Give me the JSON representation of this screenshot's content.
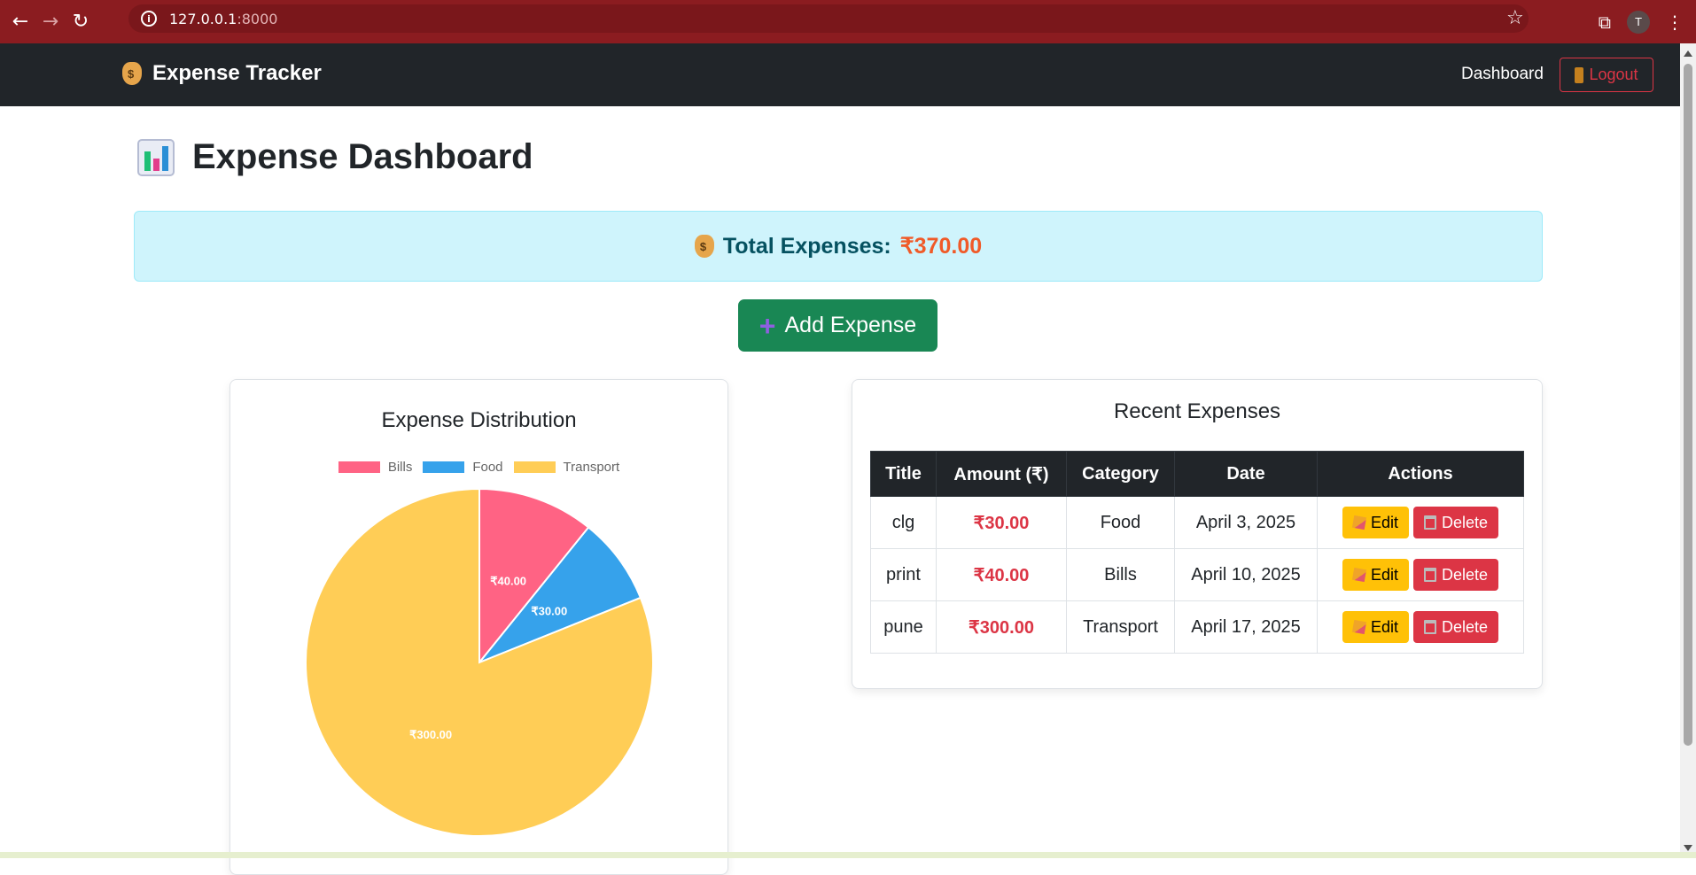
{
  "browser": {
    "url_host": "127.0.0.1",
    "url_port": ":8000",
    "profile_initial": "T"
  },
  "navbar": {
    "brand": "Expense Tracker",
    "dashboard_link": "Dashboard",
    "logout_label": "Logout"
  },
  "page": {
    "title": "Expense Dashboard",
    "total_label": "Total Expenses:",
    "total_value": "₹370.00",
    "add_button": "Add Expense"
  },
  "chart_card": {
    "title": "Expense Distribution"
  },
  "chart_data": {
    "type": "pie",
    "title": "Expense Distribution",
    "categories": [
      "Bills",
      "Food",
      "Transport"
    ],
    "values": [
      40,
      30,
      300
    ],
    "labels": [
      "₹40.00",
      "₹30.00",
      "₹300.00"
    ],
    "colors": [
      "#ff6384",
      "#36a2eb",
      "#ffcd56"
    ],
    "legend_position": "top"
  },
  "table_card": {
    "title": "Recent Expenses",
    "headers": [
      "Title",
      "Amount (₹)",
      "Category",
      "Date",
      "Actions"
    ],
    "rows": [
      {
        "title": "clg",
        "amount": "₹30.00",
        "category": "Food",
        "date": "April 3, 2025"
      },
      {
        "title": "print",
        "amount": "₹40.00",
        "category": "Bills",
        "date": "April 10, 2025"
      },
      {
        "title": "pune",
        "amount": "₹300.00",
        "category": "Transport",
        "date": "April 17, 2025"
      }
    ],
    "edit_label": "Edit",
    "delete_label": "Delete"
  }
}
